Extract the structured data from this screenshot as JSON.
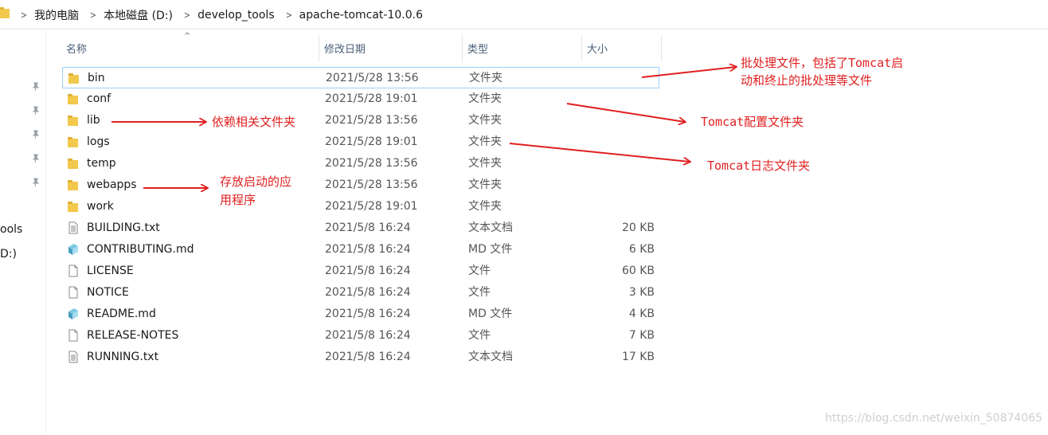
{
  "breadcrumb": {
    "items": [
      "我的电脑",
      "本地磁盘 (D:)",
      "develop_tools",
      "apache-tomcat-10.0.6"
    ]
  },
  "nav": {
    "labels": [
      "ools",
      "D:)"
    ]
  },
  "columns": {
    "name": "名称",
    "date": "修改日期",
    "type": "类型",
    "size": "大小"
  },
  "files": [
    {
      "name": "bin",
      "date": "2021/5/28 13:56",
      "type": "文件夹",
      "size": "",
      "icon": "folder-icon"
    },
    {
      "name": "conf",
      "date": "2021/5/28 19:01",
      "type": "文件夹",
      "size": "",
      "icon": "folder-icon"
    },
    {
      "name": "lib",
      "date": "2021/5/28 13:56",
      "type": "文件夹",
      "size": "",
      "icon": "folder-icon"
    },
    {
      "name": "logs",
      "date": "2021/5/28 19:01",
      "type": "文件夹",
      "size": "",
      "icon": "folder-icon"
    },
    {
      "name": "temp",
      "date": "2021/5/28 13:56",
      "type": "文件夹",
      "size": "",
      "icon": "folder-icon"
    },
    {
      "name": "webapps",
      "date": "2021/5/28 13:56",
      "type": "文件夹",
      "size": "",
      "icon": "folder-icon"
    },
    {
      "name": "work",
      "date": "2021/5/28 19:01",
      "type": "文件夹",
      "size": "",
      "icon": "folder-icon"
    },
    {
      "name": "BUILDING.txt",
      "date": "2021/5/8 16:24",
      "type": "文本文档",
      "size": "20 KB",
      "icon": "text-file-icon"
    },
    {
      "name": "CONTRIBUTING.md",
      "date": "2021/5/8 16:24",
      "type": "MD 文件",
      "size": "6 KB",
      "icon": "md-file-icon"
    },
    {
      "name": "LICENSE",
      "date": "2021/5/8 16:24",
      "type": "文件",
      "size": "60 KB",
      "icon": "blank-file-icon"
    },
    {
      "name": "NOTICE",
      "date": "2021/5/8 16:24",
      "type": "文件",
      "size": "3 KB",
      "icon": "blank-file-icon"
    },
    {
      "name": "README.md",
      "date": "2021/5/8 16:24",
      "type": "MD 文件",
      "size": "4 KB",
      "icon": "md-file-icon"
    },
    {
      "name": "RELEASE-NOTES",
      "date": "2021/5/8 16:24",
      "type": "文件",
      "size": "7 KB",
      "icon": "blank-file-icon"
    },
    {
      "name": "RUNNING.txt",
      "date": "2021/5/8 16:24",
      "type": "文本文档",
      "size": "17 KB",
      "icon": "text-file-icon"
    }
  ],
  "annotations": {
    "bin_line1": "批处理文件，包括了Tomcat启",
    "bin_line2": "动和终止的批处理等文件",
    "conf": "Tomcat配置文件夹",
    "lib": "依赖相关文件夹",
    "logs": "Tomcat日志文件夹",
    "webapps_line1": "存放启动的应",
    "webapps_line2": "用程序"
  },
  "watermark": "https://blog.csdn.net/weixin_50874065",
  "colors": {
    "annotation": "#e02020",
    "folder": "#f2c94c",
    "selection_border": "#99d1ff",
    "header_text": "#4c607a"
  }
}
